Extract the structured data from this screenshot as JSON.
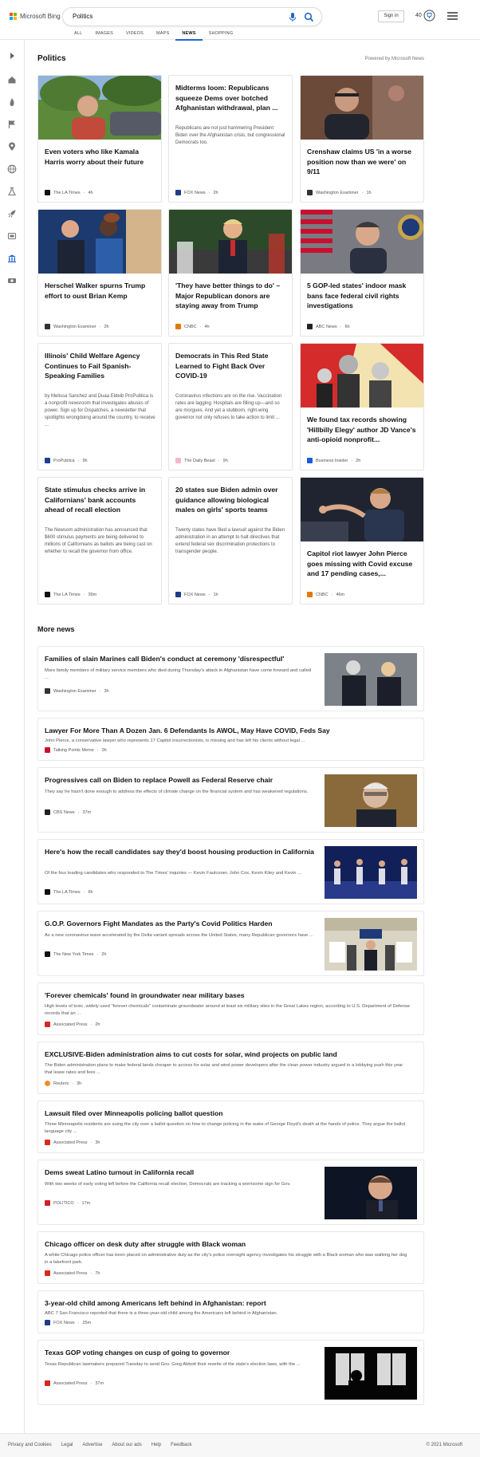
{
  "header": {
    "logo_text": "Microsoft Bing",
    "search_value": "Politics",
    "signin_label": "Sign in",
    "points": "40",
    "tabs": [
      {
        "label": "ALL"
      },
      {
        "label": "IMAGES"
      },
      {
        "label": "VIDEOS"
      },
      {
        "label": "MAPS"
      },
      {
        "label": "NEWS",
        "active": true
      },
      {
        "label": "SHOPPING"
      }
    ]
  },
  "colors": {
    "accent": "#2266cc",
    "ms_red": "#f25022",
    "ms_green": "#7fba00",
    "ms_blue": "#00a4ef",
    "ms_yellow": "#ffb900"
  },
  "sidebar_icons": [
    "expand-icon",
    "home-icon",
    "fire-icon",
    "flag-icon",
    "location-icon",
    "globe-icon",
    "science-icon",
    "rocket-icon",
    "entertainment-icon",
    "politics-icon",
    "money-icon"
  ],
  "section": {
    "title": "Politics",
    "powered": "Powered by Microsoft News"
  },
  "cards": [
    {
      "title": "Even voters who like Kamala Harris worry about their future",
      "snippet": "",
      "source": "The LA Times",
      "time": "4h",
      "favicon_color": "#111111"
    },
    {
      "title": "Midterms loom: Republicans squeeze Dems over botched Afghanistan withdrawal, plan ...",
      "snippet": "Republicans are not just hammering President Biden over the Afghanistan crisis, but congressional Democrats too.",
      "source": "FOX News",
      "time": "2h",
      "favicon_color": "#1f3c88"
    },
    {
      "title": "Crenshaw claims US 'in a worse position now than we were' on 9/11",
      "snippet": "",
      "source": "Washington Examiner",
      "time": "1h",
      "favicon_color": "#333333"
    },
    {
      "title": "Herschel Walker spurns Trump effort to oust Brian Kemp",
      "snippet": "",
      "source": "Washington Examiner",
      "time": "2h",
      "favicon_color": "#333333"
    },
    {
      "title": "'They have better things to do' – Major Republican donors are staying away from Trump",
      "snippet": "",
      "source": "CNBC",
      "time": "4h",
      "favicon_color": "#e07b00"
    },
    {
      "title": "5 GOP-led states' indoor mask bans face federal civil rights investigations",
      "snippet": "",
      "source": "ABC News",
      "time": "6h",
      "favicon_color": "#222222"
    },
    {
      "title": "Illinois' Child Welfare Agency Continues to Fail Spanish-Speaking Families",
      "snippet": "by Melissa Sanchez and Duaa Eldeib ProPublica is a nonprofit newsroom that investigates abuses of power. Sign up for Dispatches, a newsletter that spotlights wrongdoing around the country, to receive ...",
      "source": "ProPublica",
      "time": "9h",
      "favicon_color": "#1a3f8f"
    },
    {
      "title": "Democrats in This Red State Learned to Fight Back Over COVID-19",
      "snippet": "Coronavirus infections are on the rise. Vaccination rates are lagging. Hospitals are filling up—and so are morgues. And yet a stubborn, right-wing governor not only refuses to take action to limit ...",
      "source": "The Daily Beast",
      "time": "9h",
      "favicon_color": "#f5b8c4"
    },
    {
      "title": "We found tax records showing 'Hillbilly Elegy' author JD Vance's anti-opioid nonprofit...",
      "snippet": "",
      "source": "Business Insider",
      "time": "2h",
      "favicon_color": "#1e5bd6"
    },
    {
      "title": "State stimulus checks arrive in Californians' bank accounts ahead of recall election",
      "snippet": "The Newsom administration has announced that $600 stimulus payments are being delivered to millions of Californians as ballots are being cast on whether to recall the governor from office.",
      "source": "The LA Times",
      "time": "39m",
      "favicon_color": "#111111"
    },
    {
      "title": "20 states sue Biden admin over guidance allowing biological males on girls' sports teams",
      "snippet": "Twenty states have filed a lawsuit against the Biden administration in an attempt to halt directives that extend federal sex discrimination protections to transgender people.",
      "source": "FOX News",
      "time": "1h",
      "favicon_color": "#1f3c88"
    },
    {
      "title": "Capitol riot lawyer John Pierce goes missing with Covid excuse and 17 pending cases,...",
      "snippet": "",
      "source": "CNBC",
      "time": "46m",
      "favicon_color": "#e07b00"
    }
  ],
  "more_news": {
    "title": "More news",
    "items": [
      {
        "title": "Families of slain Marines call Biden's conduct at ceremony 'disrespectful'",
        "snippet": "More family members of military service members who died during Thursday's attack in Afghanistan have come forward and called ...",
        "source": "Washington Examiner",
        "time": "3h",
        "favicon_color": "#333333"
      },
      {
        "title": "Lawyer For More Than A Dozen Jan. 6 Defendants Is AWOL, May Have COVID, Feds Say",
        "snippet": "John Pierce, a conservative lawyer who represents 17 Capitol insurrectionists, is missing and has left his clients without legal ...",
        "source": "Talking Points Memo",
        "time": "3h",
        "favicon_color": "#c8102e"
      },
      {
        "title": "Progressives call on Biden to replace Powell as Federal Reserve chair",
        "snippet": "They say he hasn't done enough to address the effects of climate change on the financial system and has weakened regulations.",
        "source": "CBS News",
        "time": "37m",
        "favicon_color": "#222222"
      },
      {
        "title": "Here's how the recall candidates say they'd boost housing production in California",
        "snippet": "Of the four leading candidates who responded to The Times' inquiries — Kevin Faulconer, John Cox, Kevin Kiley and Kevin ...",
        "source": "The LA Times",
        "time": "6h",
        "favicon_color": "#111111"
      },
      {
        "title": "G.O.P. Governors Fight Mandates as the Party's Covid Politics Harden",
        "snippet": "As a new coronavirus wave accelerated by the Delta variant spreads across the United States, many Republican governors have ...",
        "source": "The New York Times",
        "time": "2h",
        "favicon_color": "#111111"
      },
      {
        "title": "'Forever chemicals' found in groundwater near military bases",
        "snippet": "High levels of toxic, widely used \"forever chemicals\" contaminate groundwater around at least six military sites in the Great Lakes region, according to U.S. Department of Defense records that an ...",
        "source": "Associated Press",
        "time": "2h",
        "favicon_color": "#d52b1e"
      },
      {
        "title": "EXCLUSIVE-Biden administration aims to cut costs for solar, wind projects on public land",
        "snippet": "The Biden administration plans to make federal lands cheaper to access for solar and wind power developers after the clean power industry argued in a lobbying push this year that lease rates and fees ...",
        "source": "Reuters",
        "time": "3h",
        "favicon_color": "#f28c28"
      },
      {
        "title": "Lawsuit filed over Minneapolis policing ballot question",
        "snippet": "Three Minneapolis residents are suing the city over a ballot question on how to change policing in the wake of George Floyd's death at the hands of police. They argue the ballot language city ...",
        "source": "Associated Press",
        "time": "3h",
        "favicon_color": "#d52b1e"
      },
      {
        "title": "Dems sweat Latino turnout in California recall",
        "snippet": "With two weeks of early voting left before the California recall election, Democrats are tracking a worrisome sign for Gov.",
        "source": "POLITICO",
        "time": "17m",
        "favicon_color": "#d21f26"
      },
      {
        "title": "Chicago officer on desk duty after struggle with Black woman",
        "snippet": "A white Chicago police officer has been placed on administrative duty as the city's police oversight agency investigates his struggle with a Black woman who was walking her dog in a lakefront park.",
        "source": "Associated Press",
        "time": "7h",
        "favicon_color": "#d52b1e"
      },
      {
        "title": "3-year-old child among Americans left behind in Afghanistan: report",
        "snippet": "ABC 7 San Francisco reported that there is a three-year-old child among the Americans left behind in Afghanistan.",
        "source": "FOX News",
        "time": "25m",
        "favicon_color": "#1f3c88"
      },
      {
        "title": "Texas GOP voting changes on cusp of going to governor",
        "snippet": "Texas Republican lawmakers prepared Tuesday to send Gov. Greg Abbott their rewrite of the state's election laws, with the ...",
        "source": "Associated Press",
        "time": "37m",
        "favicon_color": "#d52b1e"
      }
    ]
  },
  "footer": {
    "links": [
      "Privacy and Cookies",
      "Legal",
      "Advertise",
      "About our ads",
      "Help",
      "Feedback"
    ],
    "copyright": "© 2021 Microsoft"
  }
}
